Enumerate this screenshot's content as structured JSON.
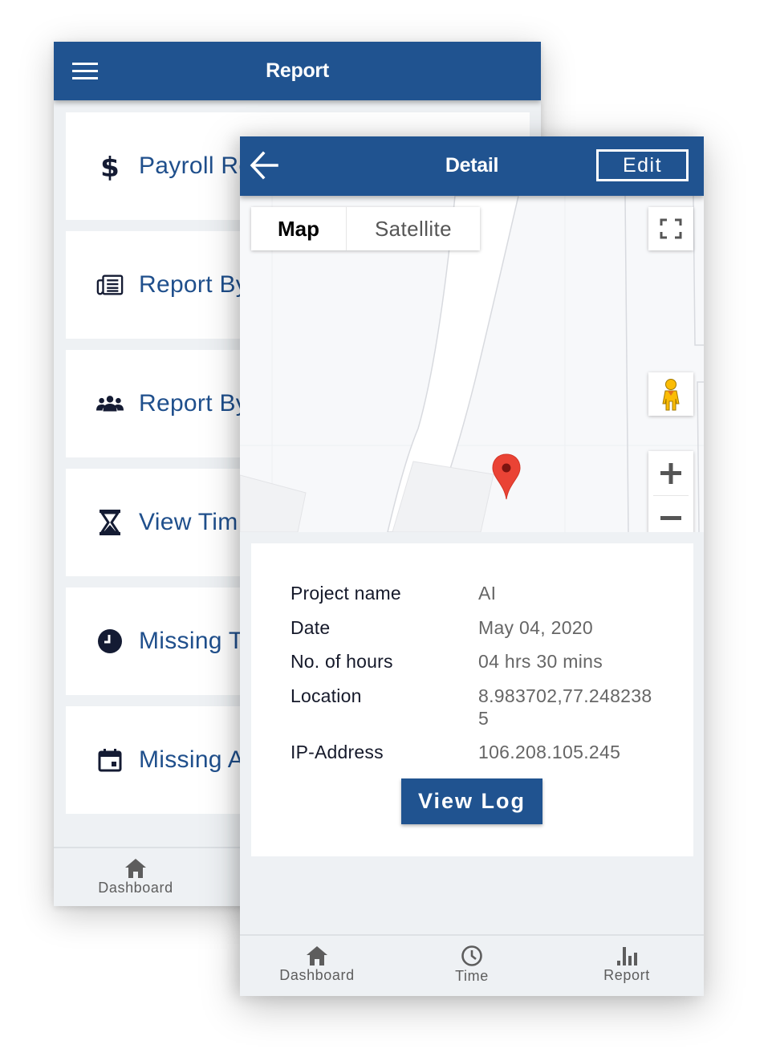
{
  "back_screen": {
    "title": "Report",
    "menu_icon": "hamburger-menu-icon",
    "items": [
      {
        "icon": "dollar-icon",
        "label": "Payroll Re"
      },
      {
        "icon": "newspaper-icon",
        "label": "Report By"
      },
      {
        "icon": "users-group-icon",
        "label": "Report By"
      },
      {
        "icon": "hourglass-icon",
        "label": "View Tim"
      },
      {
        "icon": "clock-icon",
        "label": "Missing T"
      },
      {
        "icon": "calendar-icon",
        "label": "Missing A"
      }
    ],
    "bottom_nav": [
      {
        "icon": "home-icon",
        "label": "Dashboard"
      }
    ]
  },
  "front_screen": {
    "title": "Detail",
    "back_icon": "arrow-left-icon",
    "edit_label": "Edit",
    "map": {
      "type_options": [
        "Map",
        "Satellite"
      ],
      "selected_type": "Map",
      "controls": [
        "fullscreen-icon",
        "pegman-icon",
        "zoom-in-icon",
        "zoom-out-icon"
      ],
      "marker_color": "#ea4335"
    },
    "details": [
      {
        "label": "Project name",
        "value": "AI"
      },
      {
        "label": "Date",
        "value": "May 04, 2020"
      },
      {
        "label": "No. of hours",
        "value": "04 hrs 30 mins"
      },
      {
        "label": "Location",
        "value": "8.983702,77.2482385"
      },
      {
        "label": "IP-Address",
        "value": "106.208.105.245"
      }
    ],
    "view_log_label": "View Log",
    "bottom_nav": [
      {
        "icon": "home-icon",
        "label": "Dashboard"
      },
      {
        "icon": "clock-icon",
        "label": "Time"
      },
      {
        "icon": "bar-chart-icon",
        "label": "Report"
      }
    ]
  },
  "colors": {
    "brand_blue": "#205390",
    "link_blue": "#1f4f8c",
    "icon_dark": "#141b33",
    "background": "#eef1f4"
  }
}
